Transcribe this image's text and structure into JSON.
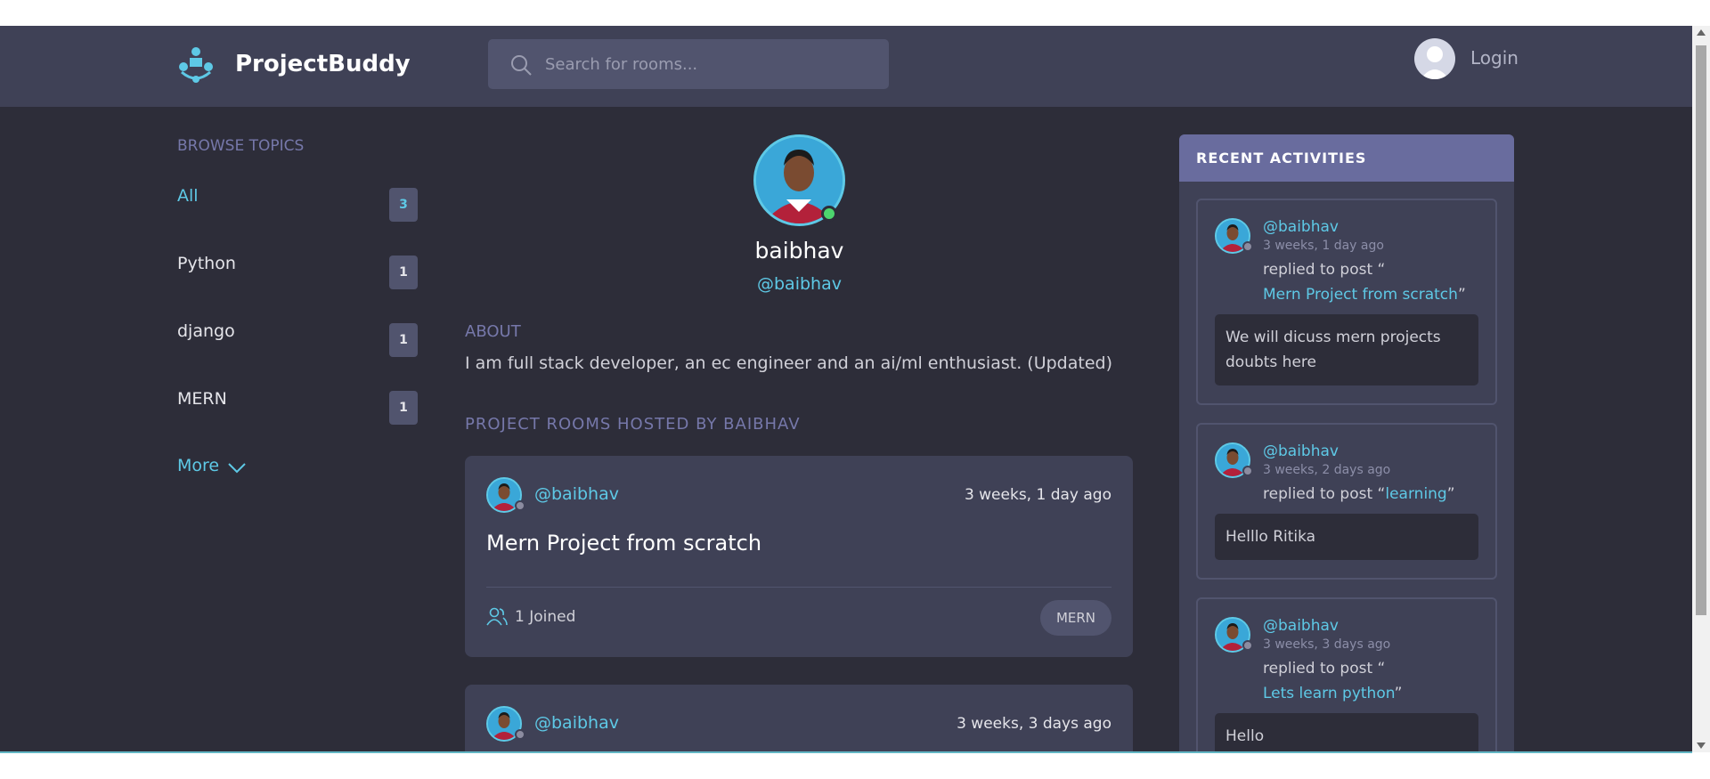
{
  "header": {
    "brand": "ProjectBuddy",
    "search_placeholder": "Search for rooms...",
    "login_label": "Login"
  },
  "sidebar": {
    "title": "BROWSE TOPICS",
    "topics": [
      {
        "name": "All",
        "count": "3"
      },
      {
        "name": "Python",
        "count": "1"
      },
      {
        "name": "django",
        "count": "1"
      },
      {
        "name": "MERN",
        "count": "1"
      }
    ],
    "more_label": "More"
  },
  "profile": {
    "name": "baibhav",
    "handle": "@baibhav",
    "about_title": "ABOUT",
    "about_text": "I am full stack developer, an ec engineer and an ai/ml enthusiast. (Updated)",
    "rooms_title": "PROJECT ROOMS HOSTED BY BAIBHAV"
  },
  "rooms": [
    {
      "host": "@baibhav",
      "time": "3 weeks, 1 day ago",
      "title": "Mern Project from scratch",
      "joined": "1 Joined",
      "tag": "MERN"
    },
    {
      "host": "@baibhav",
      "time": "3 weeks, 3 days ago"
    }
  ],
  "activities": {
    "title": "RECENT ACTIVITIES",
    "items": [
      {
        "user": "@baibhav",
        "when": "3 weeks, 1 day ago",
        "action_prefix": "replied to post “",
        "post": "Mern Project from scratch",
        "action_suffix": "”",
        "message": "We will dicuss mern projects doubts here"
      },
      {
        "user": "@baibhav",
        "when": "3 weeks, 2 days ago",
        "action_prefix": "replied to post “",
        "post": "learning",
        "action_suffix": "”",
        "message": "Helllo Ritika"
      },
      {
        "user": "@baibhav",
        "when": "3 weeks, 3 days ago",
        "action_prefix": "replied to post “",
        "post": "Lets learn python",
        "action_suffix": "”",
        "message": "Hello"
      }
    ]
  },
  "colors": {
    "accent": "#5ec9e6",
    "background": "#2d2d39",
    "panel": "#3f4156",
    "header_strip": "#696c9e",
    "online": "#4dd56e"
  }
}
